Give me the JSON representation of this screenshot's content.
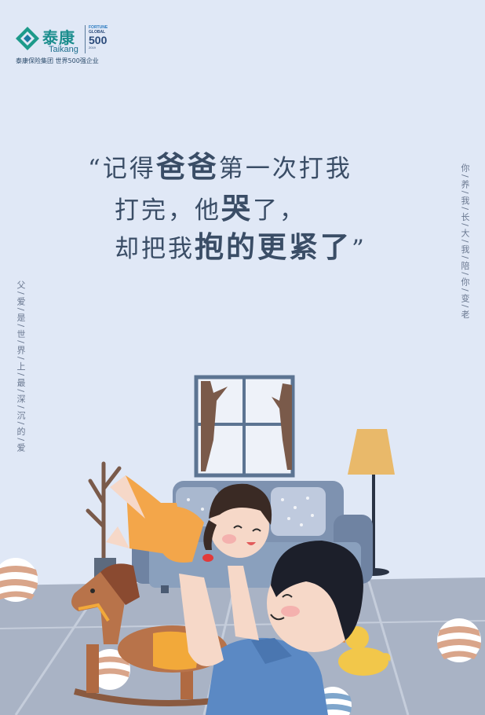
{
  "logo": {
    "brand_cn": "泰康",
    "brand_en": "Taikang",
    "fortune_line1": "FORTUNE",
    "fortune_line2": "GLOBAL",
    "fortune_number": "500",
    "fortune_year": "2019",
    "subtitle": "泰康保险集团 世界500强企业"
  },
  "quote": {
    "line1_open": "“",
    "line1_a": "记得",
    "line1_b": "爸爸",
    "line1_c": "第一次打我",
    "line2_a": "打完，他",
    "line2_b": "哭",
    "line2_c": "了，",
    "line3_a": "却把我",
    "line3_b": "抱的更紧了",
    "line3_close": "”"
  },
  "side_texts": {
    "right": "你/养/我/长/大/我/陪/你/变/老",
    "left": "父/爱/是/世/界/上/最/深/沉/的/爱"
  },
  "colors": {
    "background": "#e0e8f6",
    "floor": "#a8b2c4",
    "sofa": "#7a8eac",
    "text": "#3a4d66",
    "brand": "#1d8e8e"
  }
}
